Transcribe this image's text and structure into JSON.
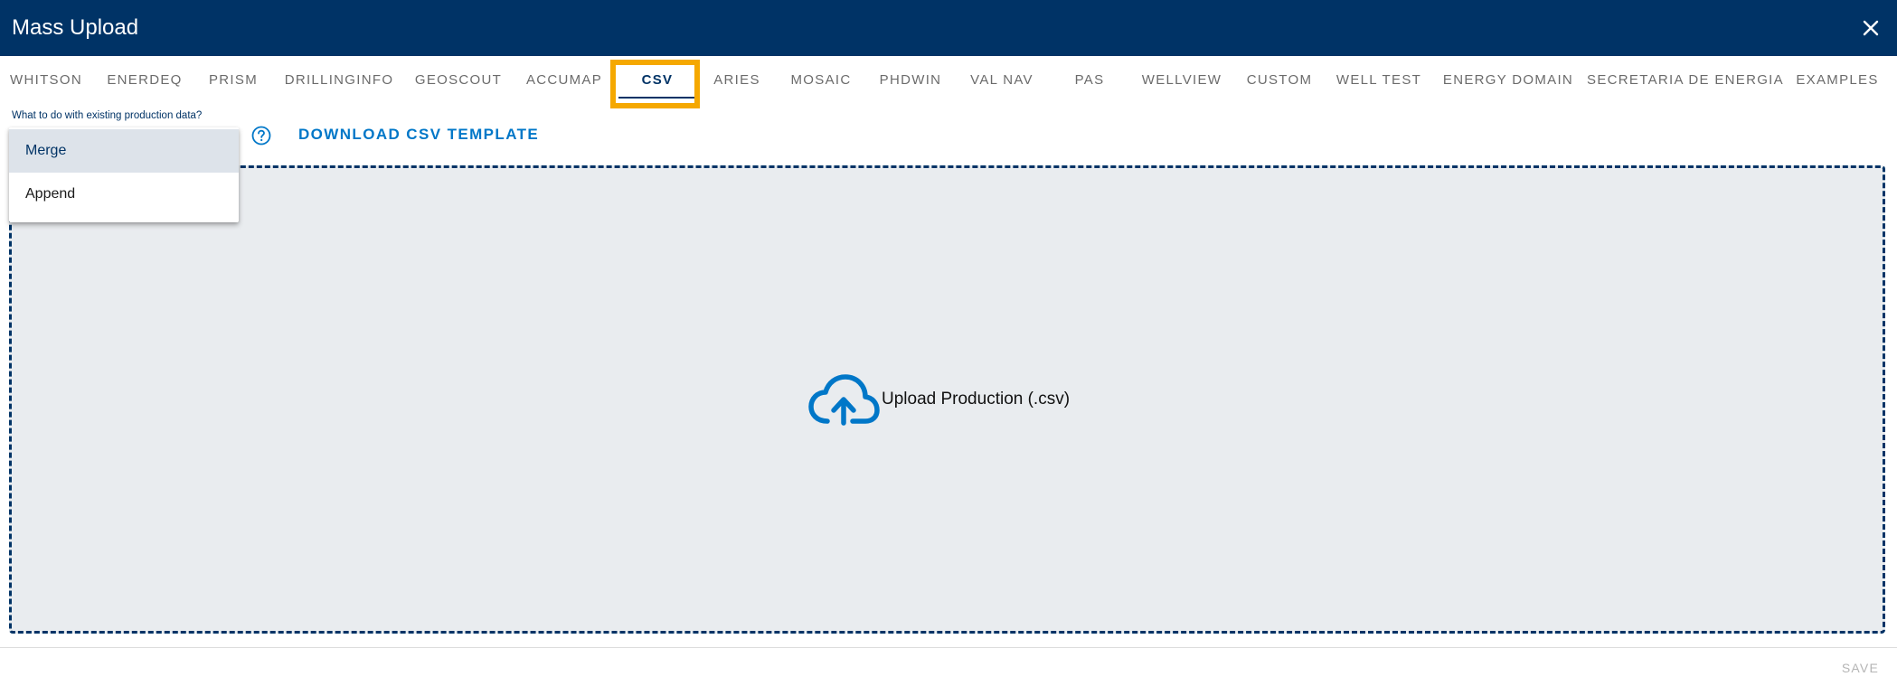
{
  "header": {
    "title": "Mass Upload",
    "close_icon": "close-icon"
  },
  "tabs": [
    {
      "label": "WHITSON"
    },
    {
      "label": "ENERDEQ"
    },
    {
      "label": "PRISM"
    },
    {
      "label": "DRILLINGINFO"
    },
    {
      "label": "GEOSCOUT"
    },
    {
      "label": "ACCUMAP"
    },
    {
      "label": "CSV",
      "active": true
    },
    {
      "label": "ARIES"
    },
    {
      "label": "MOSAIC"
    },
    {
      "label": "PHDWIN"
    },
    {
      "label": "VAL NAV"
    },
    {
      "label": "PAS"
    },
    {
      "label": "WELLVIEW"
    },
    {
      "label": "CUSTOM"
    },
    {
      "label": "WELL TEST"
    },
    {
      "label": "ENERGY DOMAIN"
    },
    {
      "label": "SECRETARIA DE ENERGIA"
    },
    {
      "label": "EXAMPLES"
    }
  ],
  "form": {
    "existing_data_label": "What to do with existing production data?",
    "help_icon": "question-circle-icon",
    "download_template_label": "DOWNLOAD CSV TEMPLATE"
  },
  "dropdown": {
    "options": [
      {
        "label": "Merge",
        "selected": true
      },
      {
        "label": "Append"
      }
    ]
  },
  "dropzone": {
    "icon": "cloud-upload-icon",
    "text": "Upload Production (.csv)"
  },
  "footer": {
    "save_label": "SAVE"
  },
  "colors": {
    "header_bg": "#003366",
    "accent_blue": "#0077c8",
    "highlight": "#F5A800",
    "dropzone_bg": "#e9ecef"
  }
}
